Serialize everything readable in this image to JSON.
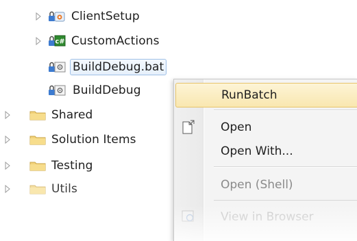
{
  "tree": {
    "items": [
      {
        "label": "ClientSetup",
        "icon": "setup-project-icon"
      },
      {
        "label": "CustomActions",
        "icon": "csharp-project-icon"
      },
      {
        "label": "BuildDebug.bat",
        "icon": "batch-file-icon"
      },
      {
        "label": "BuildDebug",
        "icon": "batch-file-icon"
      },
      {
        "label": "Shared",
        "icon": "folder-icon"
      },
      {
        "label": "Solution Items",
        "icon": "folder-icon"
      },
      {
        "label": "Testing",
        "icon": "folder-icon"
      },
      {
        "label": "Utils",
        "icon": "folder-icon"
      }
    ]
  },
  "context_menu": {
    "items": [
      {
        "label": "RunBatch",
        "state": "highlighted"
      },
      {
        "label": "Open",
        "icon": "open-document-icon"
      },
      {
        "label": "Open With..."
      },
      {
        "label": "Open (Shell)",
        "state": "disabled"
      },
      {
        "label": "View in Browser",
        "state": "faded",
        "icon": "browser-icon"
      }
    ]
  },
  "colors": {
    "highlight": "#f9e7b0",
    "highlight_border": "#e6c36a",
    "selection_border": "#9fc0e6",
    "folder": "#f2d27a",
    "menu_bg": "#f4f4f4"
  }
}
